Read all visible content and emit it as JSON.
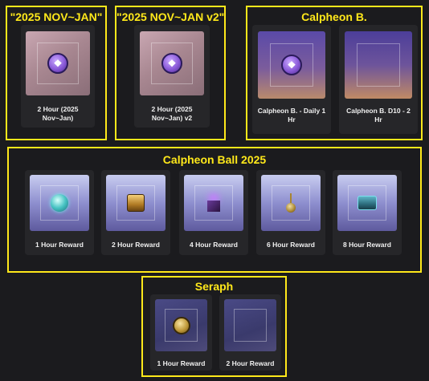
{
  "groups": {
    "nov_jan": {
      "title": "\"2025 NOV~JAN\"",
      "cards": [
        {
          "label": "2 Hour (2025 Nov~Jan)",
          "icon": "purple-coin-icon"
        }
      ]
    },
    "nov_jan_v2": {
      "title": "\"2025 NOV~JAN v2\"",
      "cards": [
        {
          "label": "2 Hour (2025 Nov~Jan) v2",
          "icon": "purple-coin-icon"
        }
      ]
    },
    "calpheon_b": {
      "title": "Calpheon B.",
      "cards": [
        {
          "label": "Calpheon B. - Daily 1 Hr",
          "icon": "purple-coin-icon"
        },
        {
          "label": "Calpheon B. D10 - 2 Hr",
          "icon": ""
        }
      ]
    },
    "calpheon_ball": {
      "title": "Calpheon Ball 2025",
      "cards": [
        {
          "label": "1 Hour Reward",
          "icon": "teal-orb-icon"
        },
        {
          "label": "2 Hour Reward",
          "icon": "gold-chest-icon"
        },
        {
          "label": "4 Hour Reward",
          "icon": "purple-cube-icon"
        },
        {
          "label": "6 Hour Reward",
          "icon": "pendant-icon"
        },
        {
          "label": "8 Hour Reward",
          "icon": "teal-chest-icon"
        }
      ]
    },
    "seraph": {
      "title": "Seraph",
      "cards": [
        {
          "label": "1 Hour Reward",
          "icon": "gold-coin-icon"
        },
        {
          "label": "2 Hour Reward",
          "icon": ""
        }
      ]
    }
  },
  "colors": {
    "accent": "#ffe81a",
    "background": "#1b1b1e",
    "card": "#262629"
  }
}
